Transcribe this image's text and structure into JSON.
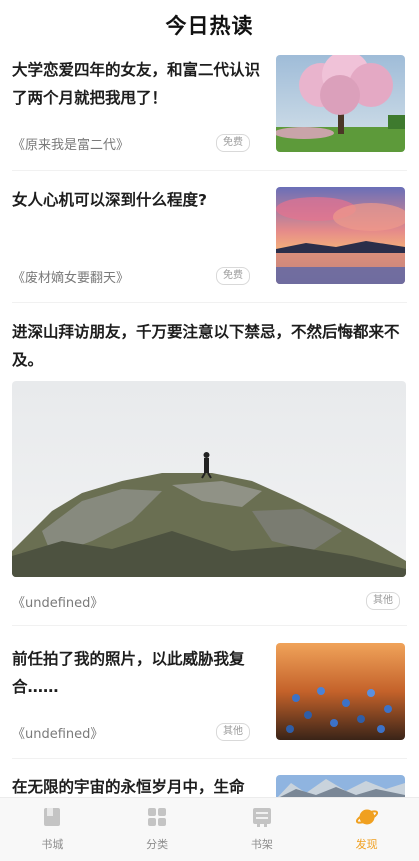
{
  "header": {
    "title": "今日热读"
  },
  "articles": [
    {
      "title": "大学恋爱四年的女友，和富二代认识了两个月就把我甩了！",
      "source": "《原来我是富二代》",
      "badge": "免费",
      "image": "cherry-blossom-tree-thumbnail"
    },
    {
      "title": "女人心机可以深到什么程度?",
      "source": "《废材嫡女要翻天》",
      "badge": "免费",
      "image": "sunset-lake-thumbnail"
    },
    {
      "title": "进深山拜访朋友，千万要注意以下禁忌，不然后悔都来不及。",
      "source": "《undefined》",
      "badge": "其他",
      "image": "mountain-hiker-photo"
    },
    {
      "title": "前任拍了我的照片，以此威胁我复合……",
      "source": "《undefined》",
      "badge": "其他",
      "image": "flowers-field-thumbnail"
    },
    {
      "title": "在无限的宇宙的永恒岁月中，生命",
      "source": "",
      "badge": "",
      "image": "snowy-mountains-thumbnail"
    }
  ],
  "tabbar": {
    "tabs": [
      {
        "label": "书城",
        "icon": "book-icon",
        "active": false
      },
      {
        "label": "分类",
        "icon": "grid-icon",
        "active": false
      },
      {
        "label": "书架",
        "icon": "bookshelf-icon",
        "active": false
      },
      {
        "label": "发现",
        "icon": "planet-icon",
        "active": true
      }
    ],
    "active_color": "#f0a020",
    "inactive_color": "#8d8d8d"
  }
}
